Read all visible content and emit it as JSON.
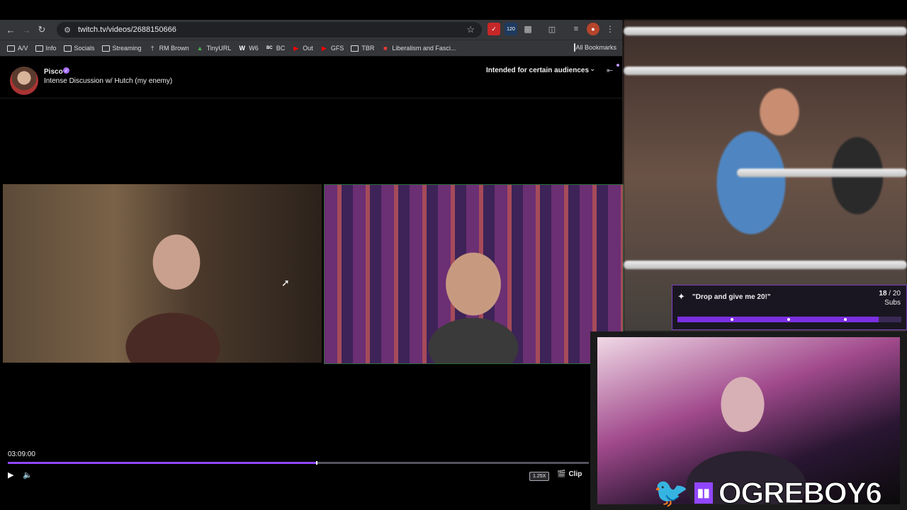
{
  "browser": {
    "url": "twitch.tv/videos/2688150666",
    "extension_badge": "120",
    "bookmarks": [
      {
        "label": "A/V",
        "icon": "folder-icon"
      },
      {
        "label": "Info",
        "icon": "folder-icon"
      },
      {
        "label": "Socials",
        "icon": "folder-icon"
      },
      {
        "label": "Streaming",
        "icon": "folder-icon"
      },
      {
        "label": "RM Brown",
        "icon": "site-icon"
      },
      {
        "label": "TinyURL",
        "icon": "site-icon"
      },
      {
        "label": "W6",
        "icon": "site-icon"
      },
      {
        "label": "BC",
        "icon": "site-icon"
      },
      {
        "label": "Out",
        "icon": "youtube-icon"
      },
      {
        "label": "GFS",
        "icon": "youtube-icon"
      },
      {
        "label": "TBR",
        "icon": "folder-icon"
      },
      {
        "label": "Liberalism and Fasci...",
        "icon": "site-icon"
      }
    ],
    "all_bookmarks": "All Bookmarks"
  },
  "twitch": {
    "channel_name": "Pisco",
    "video_title": "Intense Discussion w/ Hutch (my enemy)",
    "audience_label": "Intended for certain audiences",
    "timestamp": "03:09:00",
    "progress_fraction": 0.53,
    "speed": "1.25X",
    "clip_label": "Clip"
  },
  "overlay": {
    "goal_text": "\"Drop and give me 20!\"",
    "goal_current": "18",
    "goal_total": " / 20",
    "goal_unit": "Subs",
    "goal_fraction": 0.9,
    "handle": "OGREBOY6"
  },
  "colors": {
    "twitch_purple": "#9147ff",
    "twitter_blue": "#1d9bf0"
  }
}
